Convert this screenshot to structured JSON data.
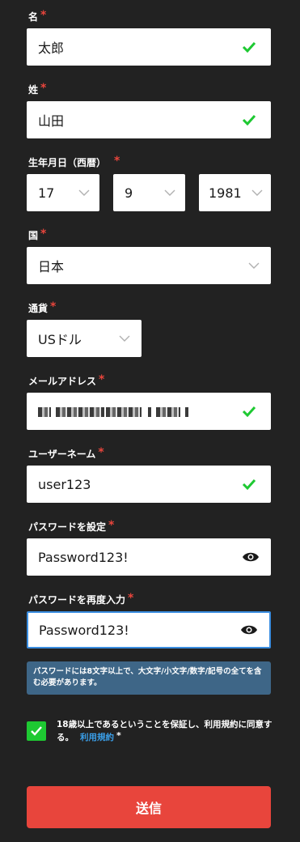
{
  "form": {
    "first_name": {
      "label": "名",
      "value": "太郎"
    },
    "last_name": {
      "label": "姓",
      "value": "山田"
    },
    "birth_date": {
      "label": "生年月日（西暦）",
      "day": "17",
      "month": "9",
      "year": "1981"
    },
    "country": {
      "label": "国",
      "value": "日本"
    },
    "currency": {
      "label": "通貨",
      "value": "USドル"
    },
    "email": {
      "label": "メールアドレス"
    },
    "username": {
      "label": "ユーザーネーム",
      "value": "user123"
    },
    "password": {
      "label": "パスワードを設定",
      "value": "Password123!"
    },
    "password_confirm": {
      "label": "パスワードを再度入力",
      "value": "Password123!"
    },
    "required_mark": "*",
    "password_hint": "パスワードには8文字以上で、大文字/小文字/数字/記号の全てを含む必要があります。",
    "agree_text": "18歳以上であるということを保証し、利用規約に同意する。",
    "agree_link": "利用規約",
    "agree_checked": true,
    "submit_label": "送信"
  },
  "colors": {
    "background": "#222222",
    "required": "#e8453c",
    "valid": "#1ec932",
    "hint_bg": "#3e6687",
    "link": "#3a9ee8",
    "submit_bg": "#e8453c",
    "focus_border": "#3a8de0"
  },
  "icons": [
    "check-icon",
    "chevron-down-icon",
    "eye-icon"
  ]
}
